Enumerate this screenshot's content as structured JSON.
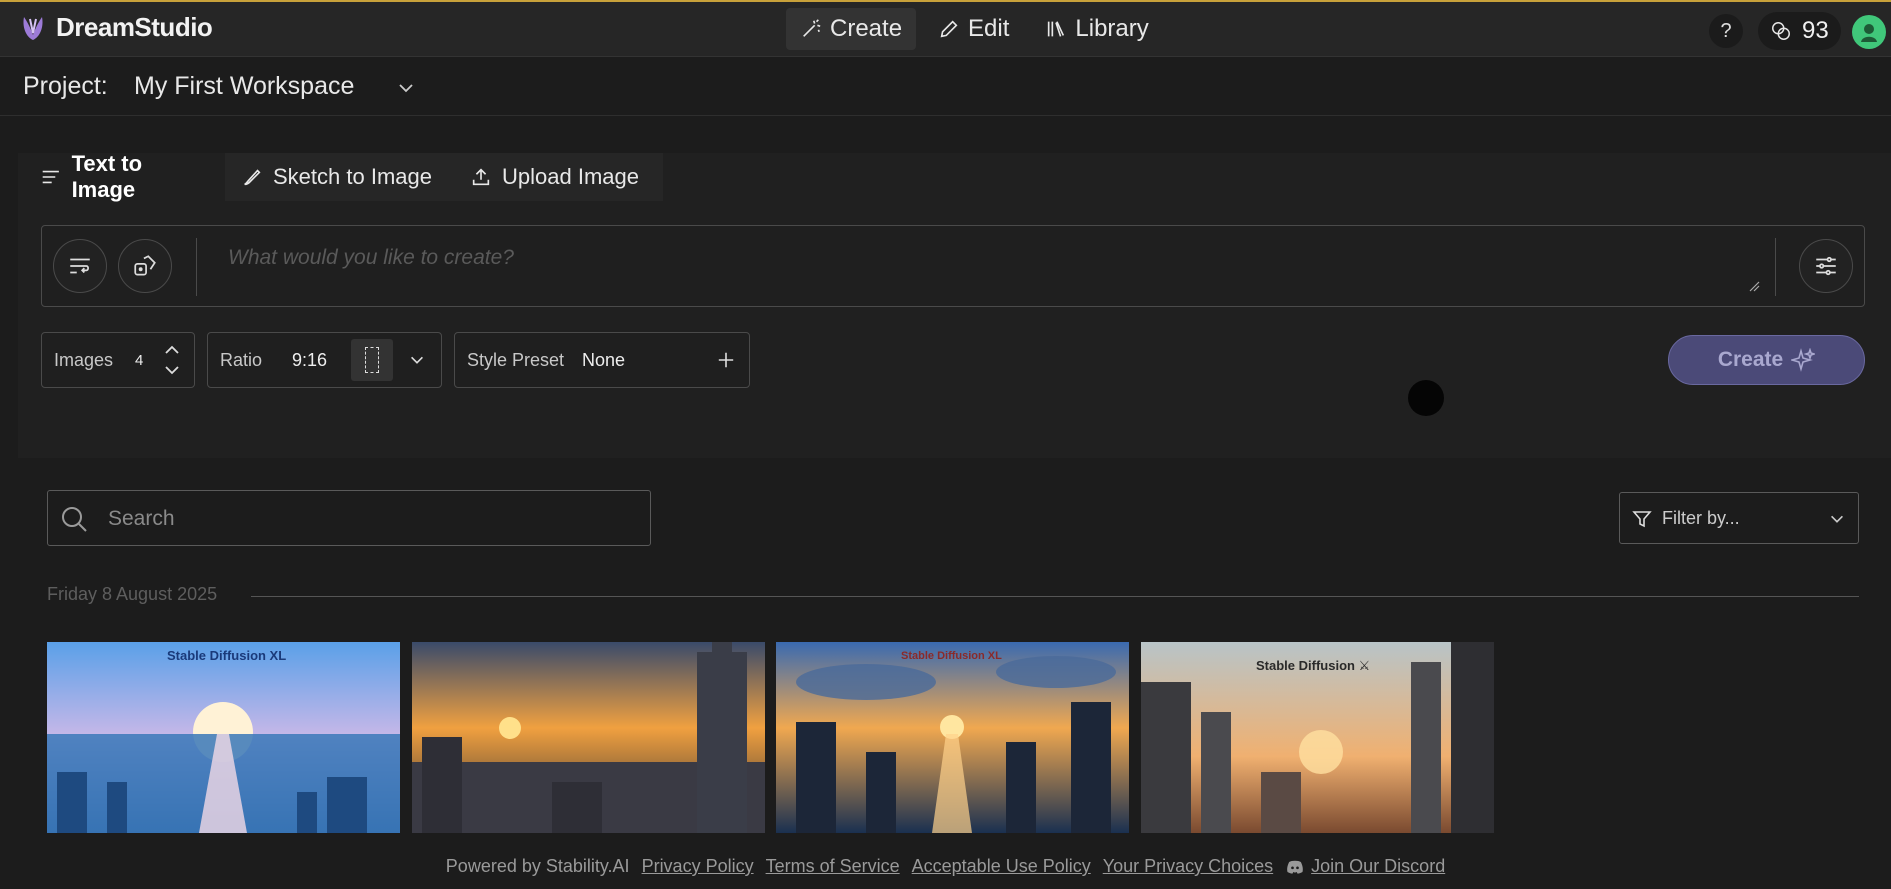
{
  "app": {
    "brand": "DreamStudio",
    "accent": "#c8a13a"
  },
  "nav": {
    "items": [
      {
        "label": "Create",
        "icon": "magic-wand-icon"
      },
      {
        "label": "Edit",
        "icon": "pencil-icon"
      },
      {
        "label": "Library",
        "icon": "library-icon"
      }
    ]
  },
  "header": {
    "help": "?",
    "credits": "93"
  },
  "project": {
    "label": "Project:",
    "name": "My First Workspace"
  },
  "tabs": [
    {
      "label": "Text to Image"
    },
    {
      "label": "Sketch to Image"
    },
    {
      "label": "Upload Image"
    }
  ],
  "prompt": {
    "placeholder": "What would you like to create?"
  },
  "controls": {
    "images_label": "Images",
    "images_value": "4",
    "ratio_label": "Ratio",
    "ratio_value": "9:16",
    "style_label": "Style Preset",
    "style_value": "None",
    "create_label": "Create",
    "create_color": "#4b4a78"
  },
  "gallery": {
    "search_placeholder": "Search",
    "filter_label": "Filter by...",
    "date": "Friday 8 August 2025",
    "thumbnails": [
      {
        "text": "Stable Diffusion XL"
      },
      {
        "text": ""
      },
      {
        "text": "Stable Diffusion XL"
      },
      {
        "text": "Stable Diffusion ⚔"
      }
    ]
  },
  "footer": {
    "powered": "Powered by Stability.AI",
    "privacy": "Privacy Policy",
    "terms": "Terms of Service",
    "aup": "Acceptable Use Policy",
    "choices": "Your Privacy Choices",
    "discord": "Join Our Discord"
  }
}
